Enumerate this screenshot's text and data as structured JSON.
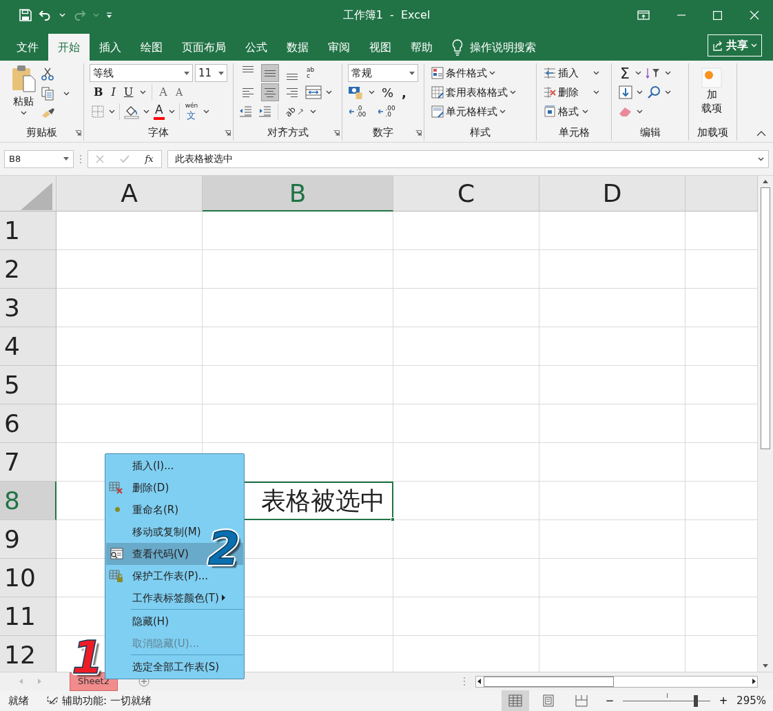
{
  "quick_access": [
    {
      "kind": "save",
      "disabled": false
    },
    {
      "kind": "undo",
      "disabled": false
    },
    {
      "kind": "redo",
      "disabled": true
    },
    {
      "kind": "customize",
      "disabled": false
    }
  ],
  "window": {
    "title": "工作簿1  -  Excel"
  },
  "ribbon_tabs": [
    {
      "label": "文件",
      "selected": false
    },
    {
      "label": "开始",
      "selected": true
    },
    {
      "label": "插入",
      "selected": false
    },
    {
      "label": "绘图",
      "selected": false
    },
    {
      "label": "页面布局",
      "selected": false
    },
    {
      "label": "公式",
      "selected": false
    },
    {
      "label": "数据",
      "selected": false
    },
    {
      "label": "审阅",
      "selected": false
    },
    {
      "label": "视图",
      "selected": false
    },
    {
      "label": "帮助",
      "selected": false
    }
  ],
  "tell_me": "操作说明搜索",
  "share_button": "共享",
  "ribbon": {
    "clipboard": {
      "paste_label": "粘贴",
      "group_label": "剪贴板"
    },
    "font": {
      "font_name": "等线",
      "font_size": "11",
      "styles": [
        "B",
        "I",
        "U"
      ],
      "grow": "A",
      "shrink": "A",
      "font_color_letter": "A",
      "phonetic_top": "wén",
      "phonetic_bottom": "文",
      "group_label": "字体"
    },
    "alignment": {
      "vertical": [
        {
          "selected": false
        },
        {
          "selected": true
        },
        {
          "selected": false
        }
      ],
      "horizontal": [
        {
          "selected": false
        },
        {
          "selected": true
        },
        {
          "selected": false
        }
      ],
      "wrap_glyphs": [
        "ab",
        "c"
      ],
      "orientation_glyph": "ab",
      "group_label": "对齐方式"
    },
    "number": {
      "format": "常规",
      "percent": "%",
      "comma": ",",
      "increase_decimal": [
        ".0",
        ".00"
      ],
      "decrease_decimal": [
        ".00",
        ".0"
      ],
      "group_label": "数字"
    },
    "styles": {
      "items": [
        "条件格式",
        "套用表格格式",
        "单元格样式"
      ],
      "group_label": "样式"
    },
    "cells": {
      "items": [
        "插入",
        "删除",
        "格式"
      ],
      "group_label": "单元格"
    },
    "editing": {
      "sum": "Σ",
      "group_label": "编辑"
    },
    "addins": {
      "button_lines": [
        "加",
        "载项"
      ],
      "group_label": "加载项"
    }
  },
  "formula_bar": {
    "name_box": "B8",
    "fx": "fx",
    "formula": "此表格被选中"
  },
  "sheet": {
    "columns": [
      {
        "label": "A",
        "selected": false
      },
      {
        "label": "B",
        "selected": true
      },
      {
        "label": "C",
        "selected": false
      },
      {
        "label": "D",
        "selected": false
      }
    ],
    "rows": [
      {
        "label": "1",
        "selected": false
      },
      {
        "label": "2",
        "selected": false
      },
      {
        "label": "3",
        "selected": false
      },
      {
        "label": "4",
        "selected": false
      },
      {
        "label": "5",
        "selected": false
      },
      {
        "label": "6",
        "selected": false
      },
      {
        "label": "7",
        "selected": false
      },
      {
        "label": "8",
        "selected": true,
        "active_text": "表格被选中"
      },
      {
        "label": "9",
        "selected": false
      },
      {
        "label": "10",
        "selected": false
      },
      {
        "label": "11",
        "selected": false
      },
      {
        "label": "12",
        "selected": false
      }
    ]
  },
  "context_menu": {
    "items": [
      {
        "label": "插入(I)...",
        "selected": false,
        "disabled": false,
        "submenu": false,
        "separator_before": false
      },
      {
        "label": "删除(D)",
        "selected": false,
        "disabled": false,
        "submenu": false,
        "separator_before": false
      },
      {
        "label": "重命名(R)",
        "selected": false,
        "disabled": false,
        "submenu": false,
        "separator_before": false
      },
      {
        "label": "移动或复制(M)",
        "selected": false,
        "disabled": false,
        "submenu": false,
        "separator_before": false
      },
      {
        "label": "查看代码(V)",
        "selected": true,
        "disabled": false,
        "submenu": false,
        "separator_before": false
      },
      {
        "label": "保护工作表(P)...",
        "selected": false,
        "disabled": false,
        "submenu": false,
        "separator_before": false
      },
      {
        "label": "工作表标签颜色(T)",
        "selected": false,
        "disabled": false,
        "submenu": true,
        "separator_before": false
      },
      {
        "label": "隐藏(H)",
        "selected": false,
        "disabled": false,
        "submenu": false,
        "separator_before": true
      },
      {
        "label": "取消隐藏(U)...",
        "selected": false,
        "disabled": true,
        "submenu": false,
        "separator_before": false
      },
      {
        "label": "选定全部工作表(S)",
        "selected": false,
        "disabled": false,
        "submenu": false,
        "separator_before": true
      }
    ]
  },
  "sheet_tabs": [
    {
      "label": "Sheet2",
      "selected": true
    }
  ],
  "annotations": [
    {
      "label": "1",
      "color": "#ee1c25"
    },
    {
      "label": "2",
      "color": "#0a6fb0"
    }
  ],
  "status_bar": {
    "mode": "就绪",
    "accessibility": "辅助功能: 一切就绪",
    "views": [
      {
        "kind": "normal",
        "selected": true
      },
      {
        "kind": "page_layout",
        "selected": false
      },
      {
        "kind": "page_break",
        "selected": false
      }
    ],
    "zoom_minus": "−",
    "zoom_plus": "+",
    "zoom": {
      "level": 0.83
    },
    "zoom_text": "295%"
  }
}
